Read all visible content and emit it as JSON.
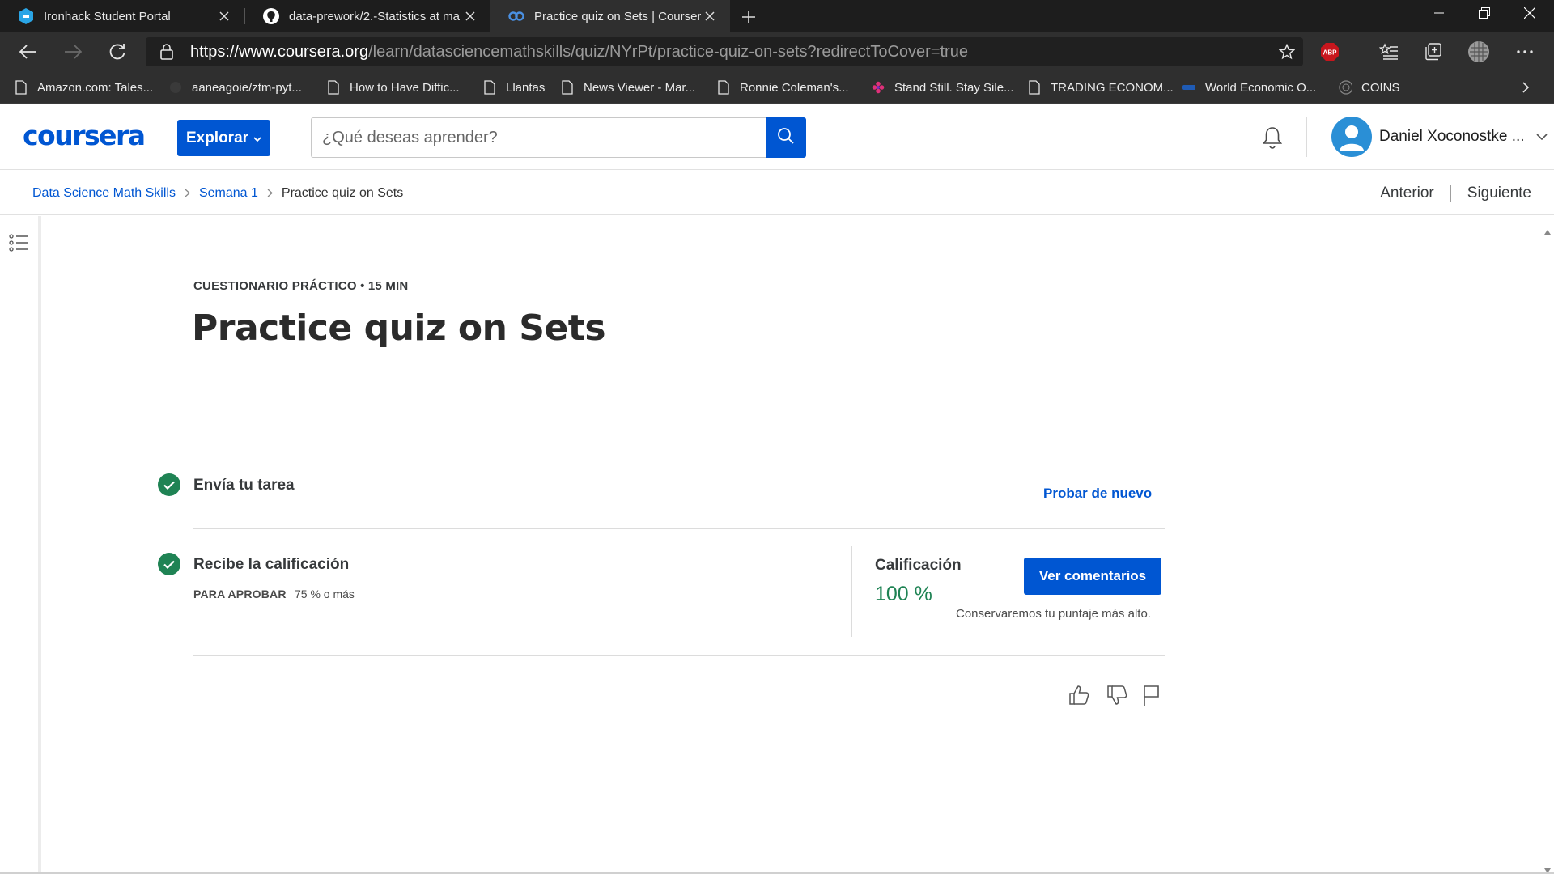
{
  "browser": {
    "tabs": [
      {
        "title": "Ironhack Student Portal",
        "icon": "ironhack-icon"
      },
      {
        "title": "data-prework/2.-Statistics at ma",
        "icon": "github-icon"
      },
      {
        "title": "Practice quiz on Sets | Coursera",
        "icon": "coursera-icon"
      }
    ],
    "url": {
      "scheme": "https://",
      "host": "www.coursera.org",
      "path": "/learn/datasciencemathskills/quiz/NYrPt/practice-quiz-on-sets?redirectToCover=true"
    },
    "extensions": {
      "adblock_label": "ABP"
    },
    "bookmarks": [
      {
        "label": "Amazon.com: Tales...",
        "icon": "page-icon"
      },
      {
        "label": "aaneagoie/ztm-pyt...",
        "icon": "github-icon"
      },
      {
        "label": "How to Have Diffic...",
        "icon": "page-icon"
      },
      {
        "label": "Llantas",
        "icon": "page-icon"
      },
      {
        "label": "News Viewer - Mar...",
        "icon": "page-icon"
      },
      {
        "label": "Ronnie Coleman's...",
        "icon": "page-icon"
      },
      {
        "label": "Stand Still. Stay Sile...",
        "icon": "flower-icon"
      },
      {
        "label": "TRADING ECONOM...",
        "icon": "page-icon"
      },
      {
        "label": "World Economic O...",
        "icon": "imf-icon"
      },
      {
        "label": "COINS",
        "icon": "coins-icon"
      }
    ]
  },
  "header": {
    "logo": "coursera",
    "explore_label": "Explorar",
    "search_placeholder": "¿Qué deseas aprender?",
    "user_name": "Daniel Xoconostke ..."
  },
  "breadcrumb": {
    "items": [
      "Data Science Math Skills",
      "Semana 1",
      "Practice quiz on Sets"
    ],
    "prev_label": "Anterior",
    "next_label": "Siguiente"
  },
  "quiz": {
    "eyebrow": "CUESTIONARIO PRÁCTICO • 15 MIN",
    "title": "Practice quiz on Sets",
    "steps": [
      {
        "title": "Envía tu tarea",
        "completed": true
      },
      {
        "title": "Recibe la calificación",
        "completed": true
      }
    ],
    "retry_label": "Probar de nuevo",
    "pass_label": "PARA APROBAR",
    "pass_value": "75 % o más",
    "grade_label": "Calificación",
    "grade_value": "100 %",
    "feedback_button": "Ver comentarios",
    "keep_note": "Conservaremos tu puntaje más alto."
  },
  "colors": {
    "brand": "#0056d2",
    "success": "#1f8354",
    "chrome_dark": "#1d1d1d"
  }
}
